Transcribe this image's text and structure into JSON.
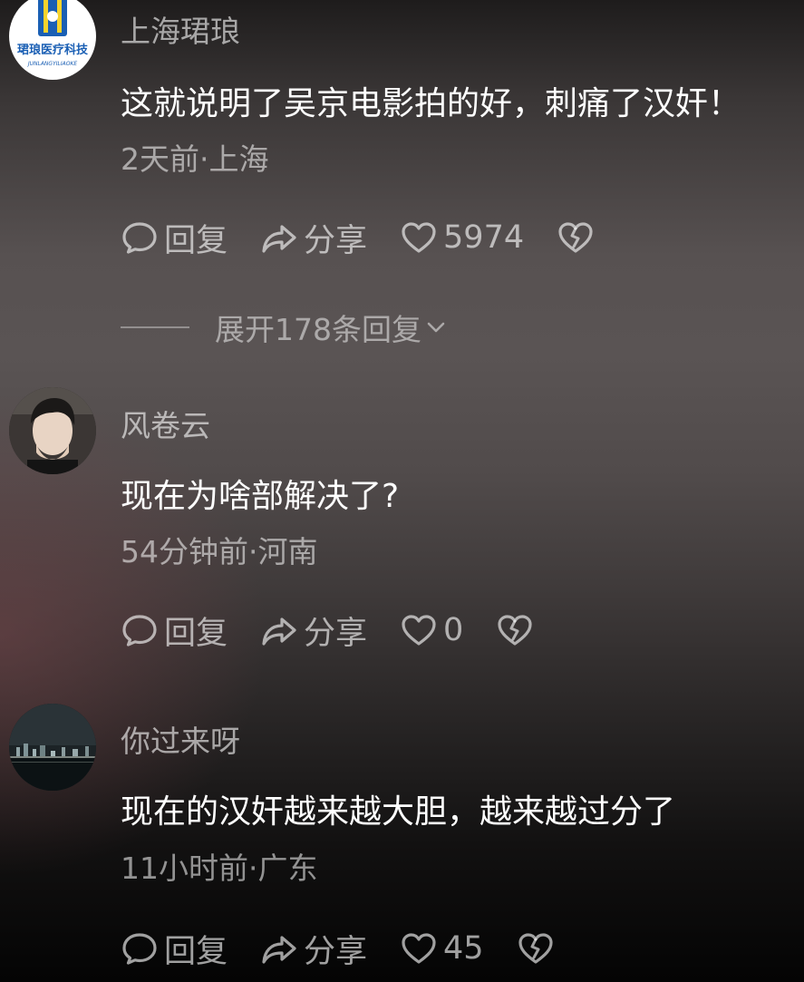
{
  "comments": [
    {
      "username": "上海珺琅",
      "text": "这就说明了吴京电影拍的好，刺痛了汉奸！",
      "meta": "2天前·上海",
      "reply_label": "回复",
      "share_label": "分享",
      "likes": "5974",
      "avatar_logo_text": "珺琅医疗科技",
      "avatar_logo_subtext": "JUNLANGYILIAOKE"
    },
    {
      "username": "风卷云",
      "text": "现在为啥部解决了?",
      "meta": "54分钟前·河南",
      "reply_label": "回复",
      "share_label": "分享",
      "likes": "0"
    },
    {
      "username": "你过来呀",
      "text": "现在的汉奸越来越大胆，越来越过分了",
      "meta": "11小时前·广东",
      "reply_label": "回复",
      "share_label": "分享",
      "likes": "45"
    }
  ],
  "expand_replies": {
    "label": "展开178条回复"
  },
  "colors": {
    "background_top": "#1e1c1c",
    "background_mid": "#575151",
    "background_bottom": "#040404",
    "text": "#ffffff"
  },
  "icons": [
    "comment-bubble-icon",
    "share-arrow-icon",
    "heart-icon",
    "broken-heart-icon",
    "chevron-down-icon"
  ]
}
